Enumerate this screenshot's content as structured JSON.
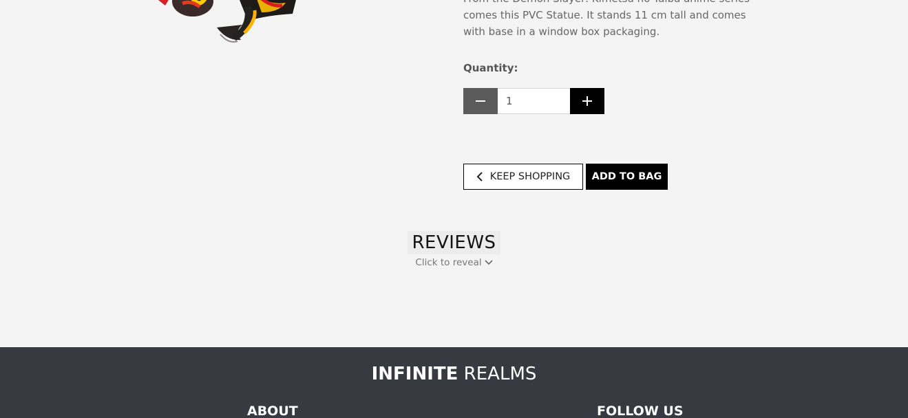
{
  "product": {
    "description_lines": [
      "From the Demon Slayer: Kimetsu no Yaiba anime series",
      "comes this PVC Statue. It stands 11 cm tall and comes",
      "with base in a window box packaging."
    ],
    "quantity_label": "Quantity:",
    "quantity_value": "1"
  },
  "actions": {
    "keep_shopping_label": "KEEP SHOPPING",
    "add_to_bag_label": "ADD TO BAG"
  },
  "reviews": {
    "title": "REVIEWS",
    "reveal_label": "Click to reveal"
  },
  "footer": {
    "brand_bold": "INFINITE",
    "brand_rest": " REALMS",
    "col_about": "ABOUT",
    "col_follow": "FOLLOW US"
  },
  "icons": {
    "minus": "minus-icon",
    "plus": "plus-icon",
    "chevron_left": "chevron-left-icon",
    "chevron_down": "chevron-down-icon"
  },
  "colors": {
    "page_background": "#f4f4f4",
    "footer_background": "#373a40",
    "primary_button": "#000000",
    "minus_button": "#5b5b5b"
  }
}
